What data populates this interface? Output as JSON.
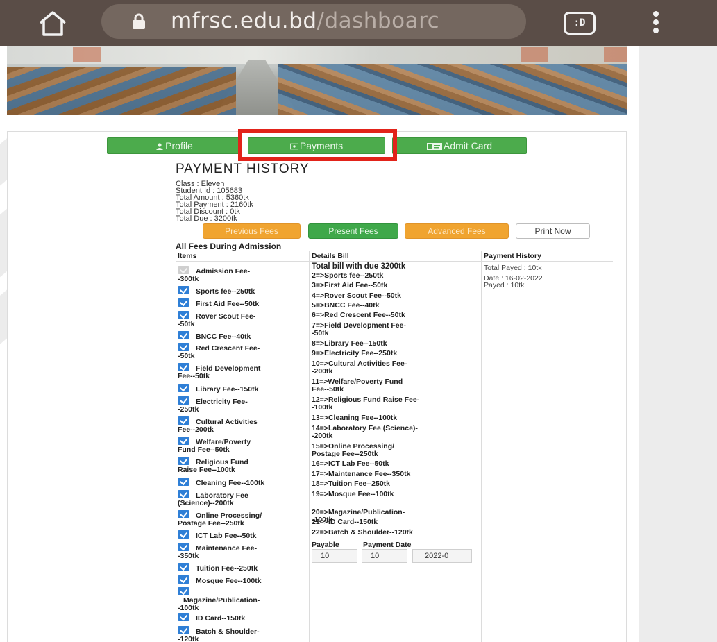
{
  "browser": {
    "url_host": "mfrsc.edu.bd",
    "url_path": "/dashboarc",
    "tabs_label": ":D"
  },
  "nav": {
    "profile": "Profile",
    "payments": "Payments",
    "admit_card": "Admit Card"
  },
  "page": {
    "title": "PAYMENT HISTORY",
    "info": [
      "Class : Eleven",
      "Student Id : 105683",
      "Total Amount : 5360tk",
      "Total Payment : 2160tk",
      "Total Discount : 0tk",
      "Total Due : 3200tk"
    ]
  },
  "fee_buttons": {
    "previous": "Previous Fees",
    "present": "Present Fees",
    "advanced": "Advanced Fees",
    "print": "Print Now"
  },
  "section_title": "All Fees During Admission",
  "table_headers": {
    "items": "Items",
    "details": "Details Bill",
    "history": "Payment History"
  },
  "items": [
    {
      "line1": "Admission Fee-",
      "line2": "-300tk",
      "checked": false
    },
    {
      "line1": "Sports fee--250tk",
      "line2": "",
      "checked": true
    },
    {
      "line1": "First Aid Fee--50tk",
      "line2": "",
      "checked": true
    },
    {
      "line1": "Rover Scout Fee-",
      "line2": "-50tk",
      "checked": true
    },
    {
      "line1": "BNCC Fee--40tk",
      "line2": "",
      "checked": true
    },
    {
      "line1": "Red Crescent Fee-",
      "line2": "-50tk",
      "checked": true
    },
    {
      "line1": "Field Development",
      "line2": "Fee--50tk",
      "checked": true
    },
    {
      "line1": "Library Fee--150tk",
      "line2": "",
      "checked": true
    },
    {
      "line1": "Electricity Fee-",
      "line2": "-250tk",
      "checked": true
    },
    {
      "line1": "Cultural Activities",
      "line2": "Fee--200tk",
      "checked": true
    },
    {
      "line1": "Welfare/Poverty",
      "line2": "Fund Fee--50tk",
      "checked": true
    },
    {
      "line1": "Religious Fund",
      "line2": "Raise Fee--100tk",
      "checked": true
    },
    {
      "line1": "Cleaning Fee--100tk",
      "line2": "",
      "checked": true
    },
    {
      "line1": "Laboratory Fee",
      "line2": "(Science)--200tk",
      "checked": true
    },
    {
      "line1": "Online Processing/",
      "line2": "Postage Fee--250tk",
      "checked": true
    },
    {
      "line1": "ICT Lab Fee--50tk",
      "line2": "",
      "checked": true
    },
    {
      "line1": "Maintenance Fee-",
      "line2": "-350tk",
      "checked": true
    },
    {
      "line1": "Tuition Fee--250tk",
      "line2": "",
      "checked": true
    },
    {
      "line1": "Mosque Fee--100tk",
      "line2": "",
      "checked": true
    },
    {
      "line1": "Magazine/Publication-",
      "line2": "-100tk",
      "checked": true
    },
    {
      "line1": "ID Card--150tk",
      "line2": "",
      "checked": true
    },
    {
      "line1": "Batch & Shoulder-",
      "line2": "-120tk",
      "checked": true
    }
  ],
  "details": {
    "total": "Total bill with due 3200tk",
    "lines": [
      {
        "line1": "2=>Sports fee--250tk",
        "line2": ""
      },
      {
        "line1": "3=>First Aid Fee--50tk",
        "line2": ""
      },
      {
        "line1": "4=>Rover Scout Fee--50tk",
        "line2": ""
      },
      {
        "line1": "5=>BNCC Fee--40tk",
        "line2": ""
      },
      {
        "line1": "6=>Red Crescent Fee--50tk",
        "line2": ""
      },
      {
        "line1": "7=>Field Development Fee-",
        "line2": "-50tk"
      },
      {
        "line1": "8=>Library Fee--150tk",
        "line2": ""
      },
      {
        "line1": "9=>Electricity Fee--250tk",
        "line2": ""
      },
      {
        "line1": "10=>Cultural Activities Fee-",
        "line2": "-200tk"
      },
      {
        "line1": "11=>Welfare/Poverty Fund",
        "line2": "Fee--50tk"
      },
      {
        "line1": "12=>Religious Fund Raise Fee-",
        "line2": "-100tk"
      },
      {
        "line1": "13=>Cleaning Fee--100tk",
        "line2": ""
      },
      {
        "line1": "14=>Laboratory Fee (Science)-",
        "line2": "-200tk"
      },
      {
        "line1": "15=>Online Processing/",
        "line2": "Postage Fee--250tk"
      },
      {
        "line1": "16=>ICT Lab Fee--50tk",
        "line2": ""
      },
      {
        "line1": "17=>Maintenance Fee--350tk",
        "line2": ""
      },
      {
        "line1": "18=>Tuition Fee--250tk",
        "line2": ""
      },
      {
        "line1": "19=>Mosque Fee--100tk",
        "line2": ""
      },
      {
        "line1": "20=>Magazine/Publication-",
        "line2": "-100tk"
      },
      {
        "line1": "21=>ID Card--150tk",
        "line2": ""
      },
      {
        "line1": "22=>Batch & Shoulder--120tk",
        "line2": ""
      }
    ],
    "payable_label": "Payable",
    "payment_date_label": "Payment Date",
    "payable_value": "10",
    "payment_value": "10",
    "date_value": "2022-0"
  },
  "history": {
    "total_payed": "Total Payed : 10tk",
    "date": "Date : 16-02-2022",
    "payed": "Payed : 10tk"
  },
  "colors": {
    "browser_bar": "#5a4d47",
    "nav_green": "#4cab4c",
    "fee_orange": "#f0a430",
    "highlight_red": "#e2231a",
    "checkbox_blue": "#2f7fd6"
  }
}
